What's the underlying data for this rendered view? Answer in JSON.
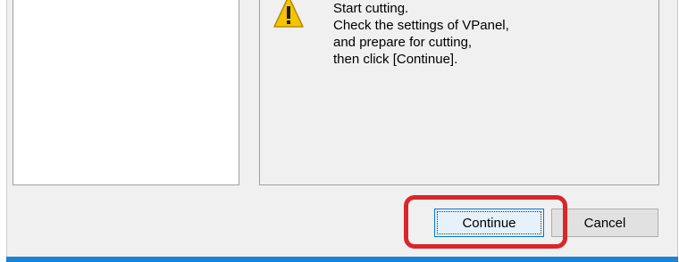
{
  "message": {
    "icon": "warning-icon",
    "lines": "Start cutting.\nCheck the settings of VPanel,\nand prepare for cutting,\nthen click [Continue]."
  },
  "buttons": {
    "continue_label": "Continue",
    "cancel_label": "Cancel"
  },
  "colors": {
    "highlight": "#d9262b",
    "accent": "#1883d7",
    "warning_fill": "#f5c400"
  }
}
